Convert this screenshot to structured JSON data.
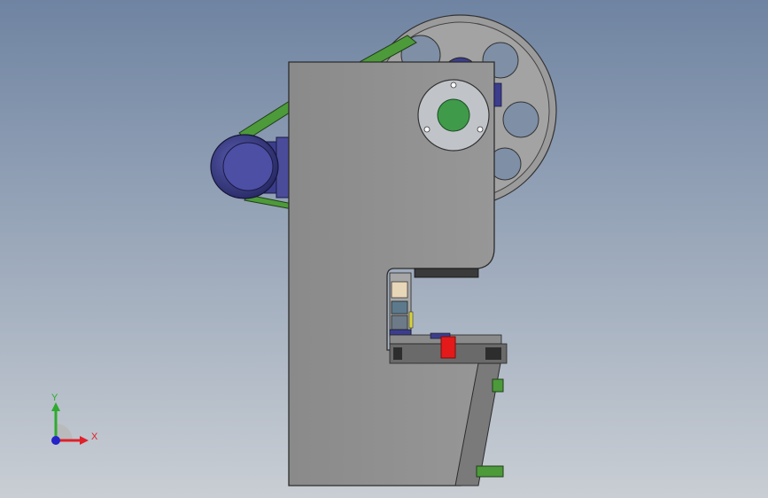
{
  "viewport": {
    "background_top": "#6f84a2",
    "background_bottom": "#c9ced4"
  },
  "triad": {
    "x_label": "X",
    "y_label": "Y",
    "x_color": "#e0202a",
    "y_color": "#2faa2f",
    "z_color": "#2424c8"
  },
  "colors": {
    "frame": "#8e8e8e",
    "frame_edge": "#2c2c2c",
    "belt": "#4d9a3a",
    "motor": "#3b3d8c",
    "flywheel": "#9a9a9a",
    "bearing_plate": "#bfc3c8",
    "shaft": "#3f9a4a",
    "safety_block": "#e41a1a"
  }
}
